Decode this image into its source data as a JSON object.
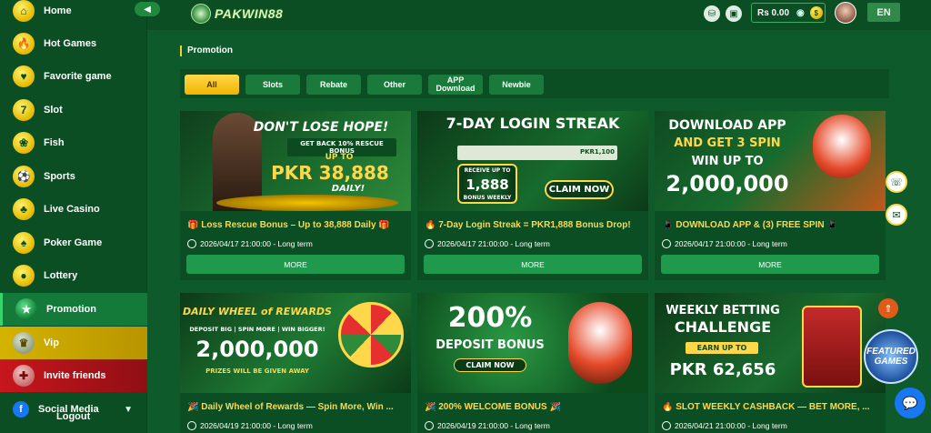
{
  "sidebar": {
    "items": [
      {
        "label": "Home",
        "icon": "home-icon",
        "glyph": "⌂"
      },
      {
        "label": "Hot Games",
        "icon": "hot-games-icon",
        "glyph": "🔥"
      },
      {
        "label": "Favorite game",
        "icon": "favorite-icon",
        "glyph": "♥"
      },
      {
        "label": "Slot",
        "icon": "slot-icon",
        "glyph": "7"
      },
      {
        "label": "Fish",
        "icon": "fish-icon",
        "glyph": "❀"
      },
      {
        "label": "Sports",
        "icon": "sports-icon",
        "glyph": "⚽"
      },
      {
        "label": "Live Casino",
        "icon": "live-casino-icon",
        "glyph": "♣"
      },
      {
        "label": "Poker Game",
        "icon": "poker-icon",
        "glyph": "♠"
      },
      {
        "label": "Lottery",
        "icon": "lottery-icon",
        "glyph": "●"
      },
      {
        "label": "Promotion",
        "icon": "promotion-icon",
        "glyph": "★"
      },
      {
        "label": "Vip",
        "icon": "vip-icon",
        "glyph": "♛"
      },
      {
        "label": "Invite friends",
        "icon": "invite-icon",
        "glyph": "✚"
      },
      {
        "label": "Social Media",
        "icon": "facebook-icon",
        "glyph": "f"
      }
    ],
    "logout": "Logout"
  },
  "header": {
    "logo": "PAKWIN88",
    "balance": "Rs 0.00",
    "lang": "EN"
  },
  "main": {
    "section_title": "Promotion",
    "tabs": [
      "All",
      "Slots",
      "Rebate",
      "Other",
      "APP Download",
      "Newbie"
    ]
  },
  "cards": [
    {
      "title": "🎁 Loss Rescue Bonus – Up to 38,888 Daily 🎁",
      "date": "2026/04/17 21:00:00 - Long term",
      "more": "MORE",
      "banner_lines": [
        "DON'T LOSE HOPE!",
        "GET BACK 10% RESCUE BONUS",
        "UP TO",
        "PKR 38,888",
        "DAILY!"
      ]
    },
    {
      "title": "🔥 7-Day Login Streak = PKR1,888 Bonus Drop!",
      "date": "2026/04/17 21:00:00 - Long term",
      "more": "MORE",
      "banner_lines": [
        "7-DAY LOGIN STREAK",
        "RECEIVE UP TO",
        "1,888",
        "BONUS WEEKLY",
        "CLAIM NOW",
        "PKR1,100"
      ]
    },
    {
      "title": "📱 DOWNLOAD APP & (3) FREE SPIN 📱",
      "date": "2026/04/17 21:00:00 - Long term",
      "more": "MORE",
      "banner_lines": [
        "DOWNLOAD APP",
        "AND GET 3 SPIN",
        "WIN UP TO",
        "2,000,000"
      ]
    },
    {
      "title": "🎉 Daily Wheel of Rewards — Spin More, Win ...",
      "date": "2026/04/19 21:00:00 - Long term",
      "banner_lines": [
        "DAILY WHEEL of REWARDS",
        "DEPOSIT BIG | SPIN MORE | WIN BIGGER!",
        "2,000,000",
        "PRIZES WILL BE GIVEN AWAY"
      ]
    },
    {
      "title": "🎉 200% WELCOME BONUS 🎉",
      "date": "2026/04/19 21:00:00 - Long term",
      "banner_lines": [
        "200%",
        "DEPOSIT BONUS",
        "CLAIM NOW"
      ]
    },
    {
      "title": "🔥 SLOT WEEKLY CASHBACK — BET MORE, ...",
      "date": "2026/04/21 21:00:00 - Long term",
      "banner_lines": [
        "WEEKLY BETTING",
        "CHALLENGE",
        "EARN UP TO",
        "PKR 62,656"
      ]
    }
  ],
  "floating": {
    "featured": "FEATURED GAMES"
  }
}
